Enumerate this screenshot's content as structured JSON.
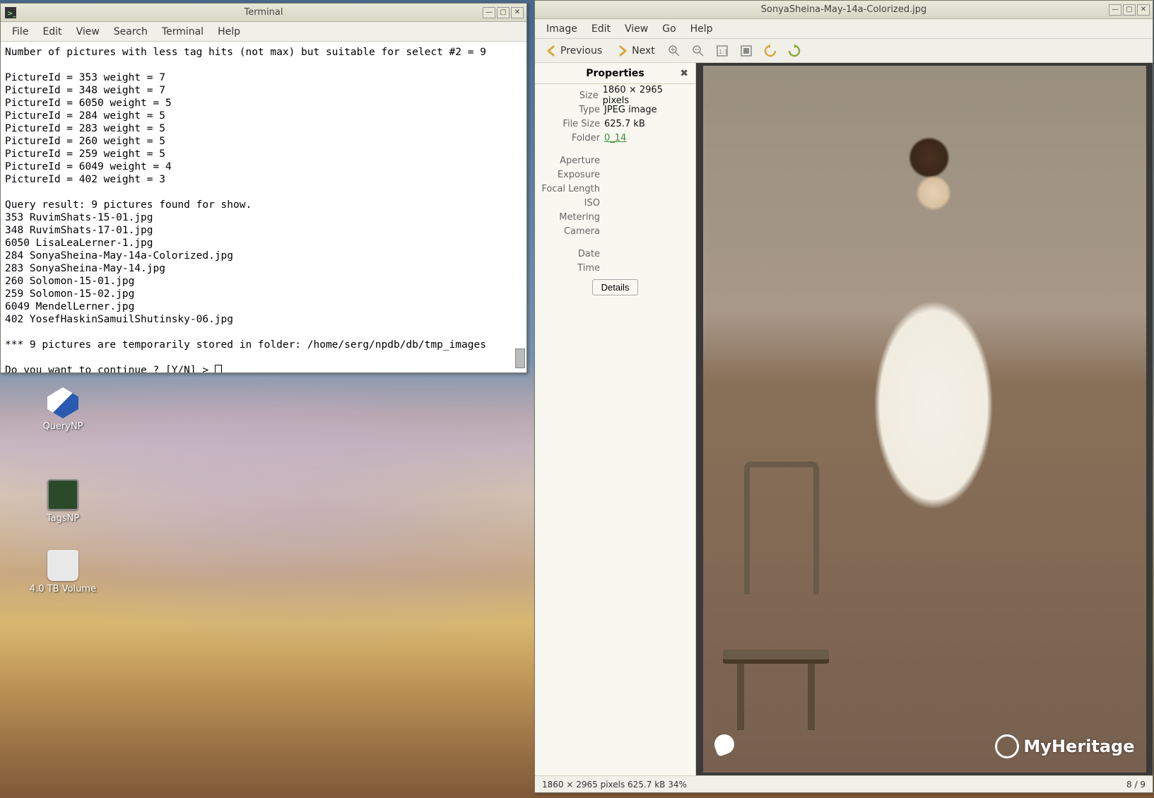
{
  "terminal": {
    "title": "Terminal",
    "menu": [
      "File",
      "Edit",
      "View",
      "Search",
      "Terminal",
      "Help"
    ],
    "lines": [
      "Number of pictures with less tag hits (not max) but suitable for select #2 = 9",
      "",
      "PictureId = 353 weight = 7",
      "PictureId = 348 weight = 7",
      "PictureId = 6050 weight = 5",
      "PictureId = 284 weight = 5",
      "PictureId = 283 weight = 5",
      "PictureId = 260 weight = 5",
      "PictureId = 259 weight = 5",
      "PictureId = 6049 weight = 4",
      "PictureId = 402 weight = 3",
      "",
      "Query result: 9 pictures found for show.",
      "353 RuvimShats-15-01.jpg",
      "348 RuvimShats-17-01.jpg",
      "6050 LisaLeaLerner-1.jpg",
      "284 SonyaSheina-May-14a-Colorized.jpg",
      "283 SonyaSheina-May-14.jpg",
      "260 Solomon-15-01.jpg",
      "259 Solomon-15-02.jpg",
      "6049 MendelLerner.jpg",
      "402 YosefHaskinSamuilShutinsky-06.jpg",
      "",
      "*** 9 pictures are temporarily stored in folder: /home/serg/npdb/db/tmp_images",
      "",
      "Do you want to continue ? [Y/N] > "
    ]
  },
  "viewer": {
    "title": "SonyaSheina-May-14a-Colorized.jpg",
    "menu": [
      "Image",
      "Edit",
      "View",
      "Go",
      "Help"
    ],
    "toolbar": {
      "previous": "Previous",
      "next": "Next"
    },
    "properties": {
      "title": "Properties",
      "rows": {
        "size_l": "Size",
        "size_v": "1860 × 2965 pixels",
        "type_l": "Type",
        "type_v": "JPEG image",
        "fsize_l": "File Size",
        "fsize_v": "625.7 kB",
        "folder_l": "Folder",
        "folder_v": "0_14",
        "aperture_l": "Aperture",
        "aperture_v": "",
        "exposure_l": "Exposure",
        "exposure_v": "",
        "focal_l": "Focal Length",
        "focal_v": "",
        "iso_l": "ISO",
        "iso_v": "",
        "metering_l": "Metering",
        "metering_v": "",
        "camera_l": "Camera",
        "camera_v": "",
        "date_l": "Date",
        "date_v": "",
        "time_l": "Time",
        "time_v": ""
      },
      "details": "Details"
    },
    "heritage": "MyHeritage",
    "status": {
      "left": "1860 × 2965 pixels   625.7 kB   34%",
      "right": "8 / 9"
    }
  },
  "desktop": {
    "icons": {
      "querynp": "QueryNP",
      "tagsnp": "TagsNP",
      "volume": "4.0 TB Volume"
    }
  }
}
